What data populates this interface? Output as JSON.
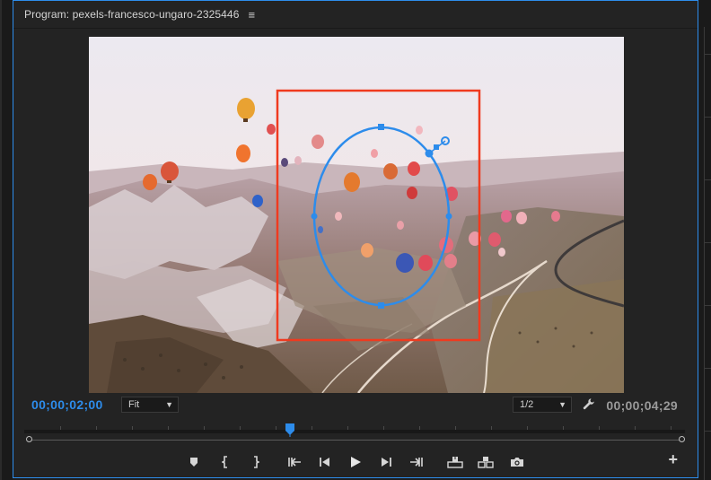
{
  "panel": {
    "title": "Program: pexels-francesco-ungaro-2325446",
    "menu_icon": "hamburger-menu-icon"
  },
  "viewer": {
    "image": "hot-air-balloons-over-rocky-valley",
    "mask_color": "#2d8ceb",
    "crop_box_color": "#f03a1f"
  },
  "controls": {
    "current_timecode": "00;00;02;00",
    "zoom": "Fit",
    "resolution": "1/2",
    "duration_timecode": "00;00;04;29",
    "settings_icon": "wrench-icon"
  },
  "playhead_fraction": 0.4,
  "transport": {
    "buttons": [
      {
        "name": "add-marker-button",
        "icon": "marker-icon"
      },
      {
        "name": "mark-in-button",
        "icon": "mark-in-icon"
      },
      {
        "name": "mark-out-button",
        "icon": "mark-out-icon"
      },
      {
        "name": "go-to-in-button",
        "icon": "go-to-in-icon"
      },
      {
        "name": "step-back-button",
        "icon": "step-back-icon"
      },
      {
        "name": "play-button",
        "icon": "play-icon"
      },
      {
        "name": "step-forward-button",
        "icon": "step-forward-icon"
      },
      {
        "name": "go-to-out-button",
        "icon": "go-to-out-icon"
      },
      {
        "name": "lift-button",
        "icon": "lift-icon"
      },
      {
        "name": "extract-button",
        "icon": "extract-icon"
      },
      {
        "name": "export-frame-button",
        "icon": "camera-icon"
      }
    ],
    "add_button_label": "+"
  },
  "colors": {
    "accent": "#2d8ceb",
    "panel_bg": "#232323",
    "text": "#c9c9c9"
  }
}
